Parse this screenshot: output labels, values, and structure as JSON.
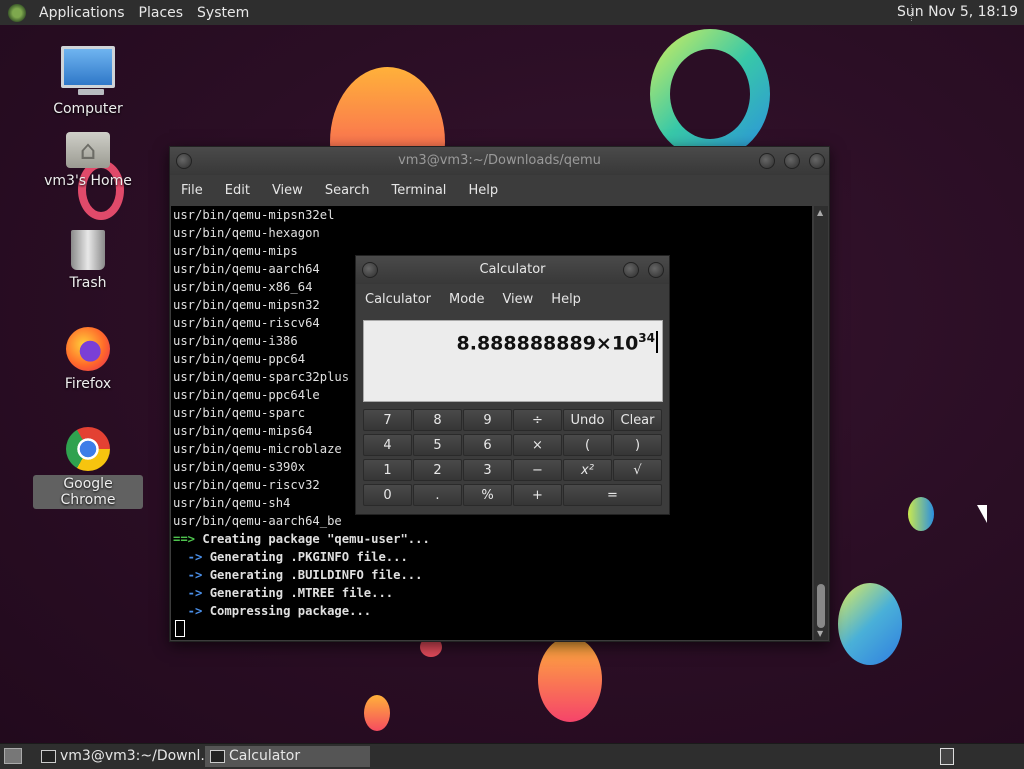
{
  "top_panel": {
    "menus": [
      "Applications",
      "Places",
      "System"
    ],
    "clock": "Sun Nov  5, 18:19"
  },
  "desktop_icons": [
    {
      "label": "Computer",
      "icon": "computer-icon"
    },
    {
      "label": "vm3's Home",
      "icon": "home-folder-icon"
    },
    {
      "label": "Trash",
      "icon": "trash-icon"
    },
    {
      "label": "Firefox",
      "icon": "firefox-icon"
    },
    {
      "label": "Google Chrome",
      "icon": "chrome-icon"
    }
  ],
  "terminal": {
    "title": "vm3@vm3:~/Downloads/qemu",
    "menus": [
      "File",
      "Edit",
      "View",
      "Search",
      "Terminal",
      "Help"
    ],
    "lines": [
      "usr/bin/qemu-mipsn32el",
      "usr/bin/qemu-hexagon",
      "usr/bin/qemu-mips",
      "usr/bin/qemu-aarch64",
      "usr/bin/qemu-x86_64",
      "usr/bin/qemu-mipsn32",
      "usr/bin/qemu-riscv64",
      "usr/bin/qemu-i386",
      "usr/bin/qemu-ppc64",
      "usr/bin/qemu-sparc32plus",
      "usr/bin/qemu-ppc64le",
      "usr/bin/qemu-sparc",
      "usr/bin/qemu-mips64",
      "usr/bin/qemu-microblaze",
      "usr/bin/qemu-s390x",
      "usr/bin/qemu-riscv32",
      "usr/bin/qemu-sh4",
      "usr/bin/qemu-aarch64_be"
    ],
    "status_lines": [
      {
        "prefix": "==>",
        "text": " Creating package \"qemu-user\"..."
      },
      {
        "prefix": "  ->",
        "text": " Generating .PKGINFO file..."
      },
      {
        "prefix": "  ->",
        "text": " Generating .BUILDINFO file..."
      },
      {
        "prefix": "  ->",
        "text": " Generating .MTREE file..."
      },
      {
        "prefix": "  ->",
        "text": " Compressing package..."
      }
    ]
  },
  "calculator": {
    "title": "Calculator",
    "menus": [
      "Calculator",
      "Mode",
      "View",
      "Help"
    ],
    "display_mantissa": "8.888888889×10",
    "display_exponent": "34",
    "keys": [
      [
        "7",
        "8",
        "9",
        "÷",
        "Undo",
        "Clear"
      ],
      [
        "4",
        "5",
        "6",
        "×",
        "(",
        ")"
      ],
      [
        "1",
        "2",
        "3",
        "−",
        "x²",
        "√"
      ],
      [
        "0",
        ".",
        "%",
        "+",
        "="
      ]
    ]
  },
  "taskbar": {
    "tasks": [
      {
        "label": "vm3@vm3:~/Downl...",
        "active": false
      },
      {
        "label": "Calculator",
        "active": true
      }
    ]
  }
}
